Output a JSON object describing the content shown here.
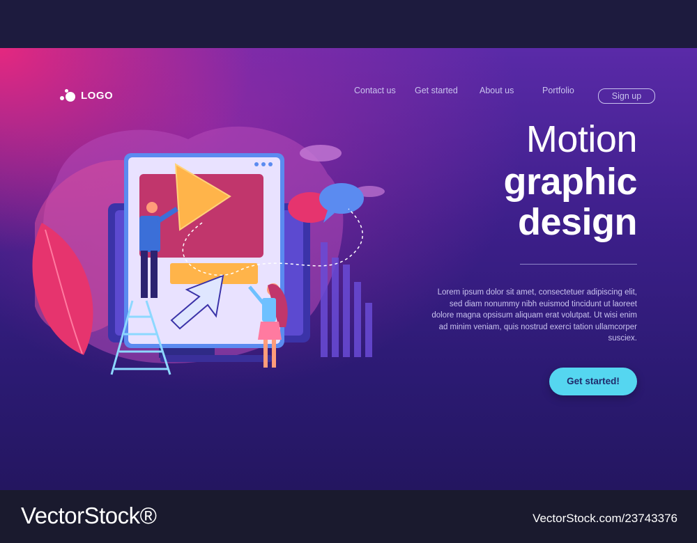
{
  "header": {
    "logo_text": "LOGO",
    "nav": [
      "Contact us",
      "Get started",
      "About us",
      "Portfolio"
    ],
    "signup_label": "Sign up"
  },
  "hero": {
    "title_line1": "Motion",
    "title_line2": "graphic",
    "title_line3": "design",
    "body": "Lorem ipsum dolor sit amet, consectetuer adipiscing elit, sed diam nonummy nibh euismod tincidunt ut laoreet dolore magna opsisum aliquam erat volutpat. Ut wisi enim ad minim veniam, quis nostrud exerci tation ullamcorper susciex.",
    "cta_label": "Get started!"
  },
  "watermark": {
    "brand": "VectorStock®",
    "url": "VectorStock.com/23743376"
  },
  "colors": {
    "accent": "#55d6f0",
    "hero_pink": "#eb287d",
    "hero_purple": "#3d1f8a",
    "nav_text": "#c9c3ee"
  },
  "icons": [
    "logo-mark-icon",
    "play-icon",
    "cursor-arrow-icon",
    "speech-bubble-icon",
    "ladder-icon"
  ]
}
